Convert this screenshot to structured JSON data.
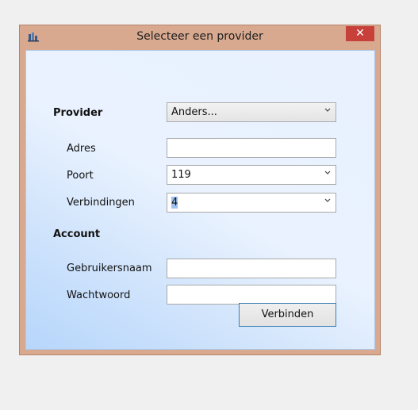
{
  "window": {
    "title": "Selecteer een provider",
    "close_glyph": "✕",
    "app_icon": "network-icon"
  },
  "form": {
    "provider_label": "Provider",
    "provider_value": "Anders...",
    "address_label": "Adres",
    "address_value": "",
    "port_label": "Poort",
    "port_value": "119",
    "connections_label": "Verbindingen",
    "connections_value": "4",
    "account_heading": "Account",
    "username_label": "Gebruikersnaam",
    "username_value": "",
    "password_label": "Wachtwoord",
    "password_value": "",
    "connect_label": "Verbinden"
  }
}
